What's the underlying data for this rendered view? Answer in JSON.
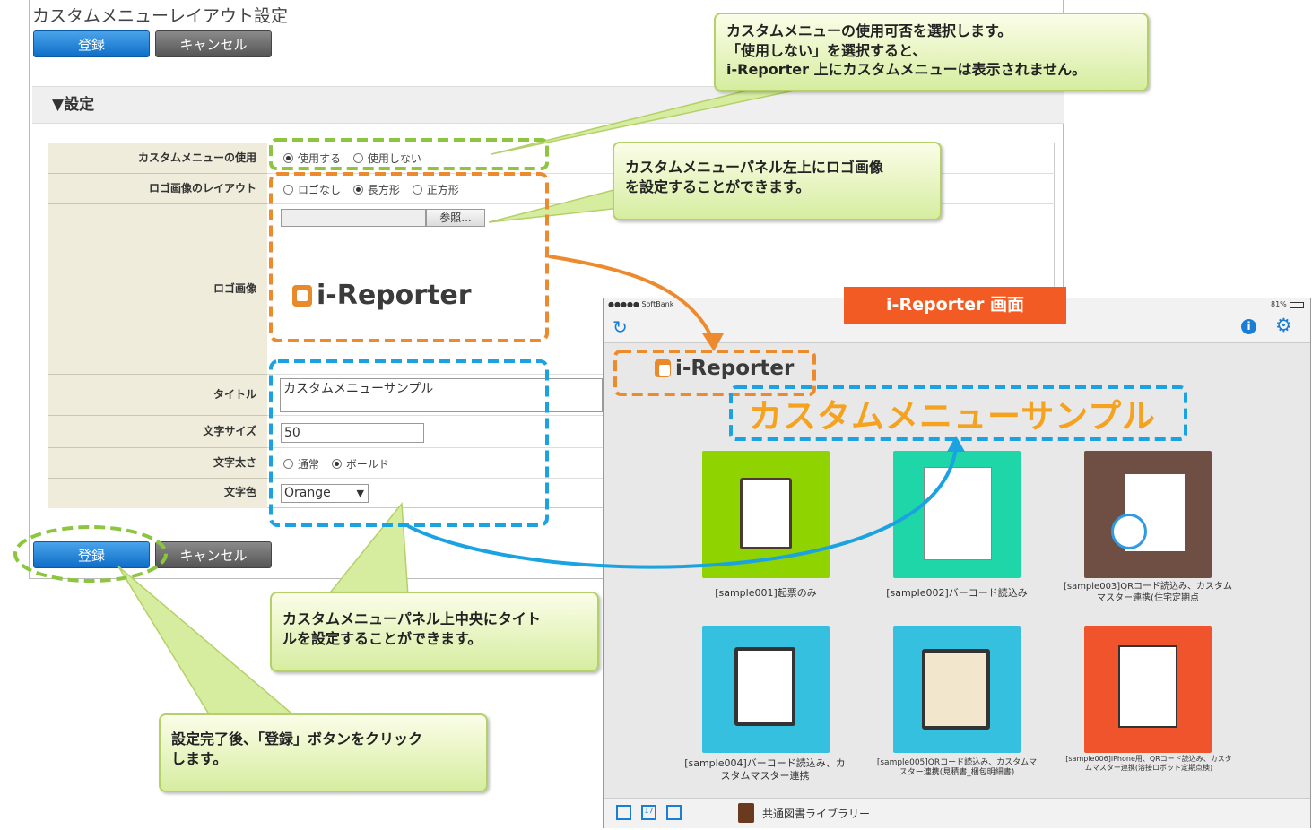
{
  "admin": {
    "title": "カスタムメニューレイアウト設定",
    "register_label": "登録",
    "cancel_label": "キャンセル",
    "section_title": "▼設定",
    "rows": {
      "use_label": "カスタムメニューの使用",
      "use_options": [
        "使用する",
        "使用しない"
      ],
      "layout_label": "ロゴ画像のレイアウト",
      "layout_options": [
        "ロゴなし",
        "長方形",
        "正方形"
      ],
      "browse_label": "参照...",
      "logo_label": "ロゴ画像",
      "logo_text": "i-Reporter",
      "title_label": "タイトル",
      "title_value": "カスタムメニューサンプル",
      "font_size_label": "文字サイズ",
      "font_size_value": "50",
      "font_weight_label": "文字太さ",
      "font_weight_options": [
        "通常",
        "ボールド"
      ],
      "font_color_label": "文字色",
      "font_color_value": "Orange"
    }
  },
  "callouts": {
    "use": [
      "カスタムメニューの使用可否を選択します。",
      "「使用しない」を選択すると、",
      "i-Reporter 上にカスタムメニューは表示されません。"
    ],
    "logo": [
      "カスタムメニューパネル左上にロゴ画像",
      "を設定することができます。"
    ],
    "title": [
      "カスタムメニューパネル上中央にタイト",
      "ルを設定することができます。"
    ],
    "register": [
      "設定完了後、「登録」ボタンをクリック",
      "します。"
    ]
  },
  "ipad": {
    "screen_label": "i-Reporter 画面",
    "carrier": "●●●●● SoftBank",
    "battery": "81%",
    "logo_text": "i-Reporter",
    "menu_title": "カスタムメニューサンプル",
    "tiles": [
      {
        "caption": "[sample001]起票のみ",
        "color": "#8fd400"
      },
      {
        "caption": "[sample002]バーコード読込み",
        "color": "#1fd6a8"
      },
      {
        "caption": "[sample003]QRコード読込み、カスタムマスター連携(住宅定期点",
        "color": "#6f4e43"
      },
      {
        "caption": "[sample004]バーコード読込み、カスタムマスター連携",
        "color": "#35c0e0"
      },
      {
        "caption": "[sample005]QRコード読込み、カスタムマスター連携(見積書_梱包明細書)",
        "color": "#35c0e0"
      },
      {
        "caption": "[sample006]iPhone用、QRコード読込み、カスタムマスター連携(溶接ロボット定期点検)",
        "color": "#f0542c"
      }
    ],
    "library_label": "共通図書ライブラリー"
  },
  "colors": {
    "green_dash": "#8cc63f",
    "orange_dash": "#ee8a2e",
    "blue_dash": "#1aa3e0",
    "title_orange": "#f5a21e"
  }
}
